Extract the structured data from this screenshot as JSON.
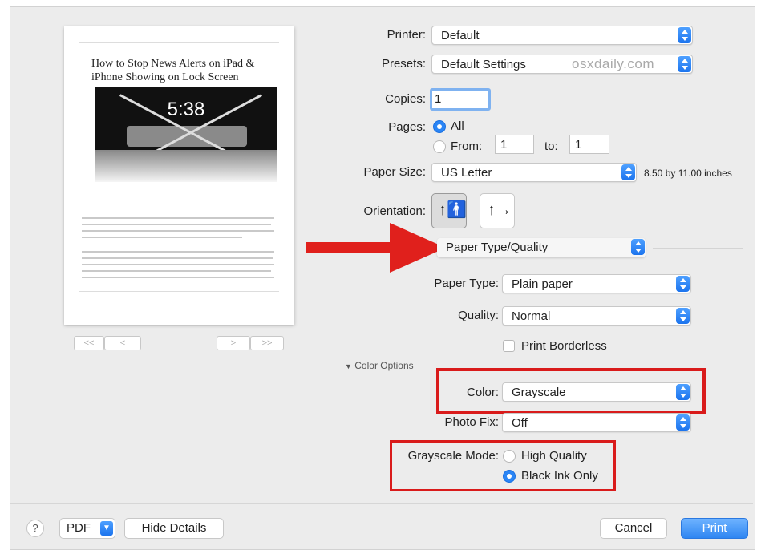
{
  "printer": {
    "label": "Printer:",
    "value": "Default"
  },
  "presets": {
    "label": "Presets:",
    "value": "Default Settings"
  },
  "watermark": "osxdaily.com",
  "copies": {
    "label": "Copies:",
    "value": "1"
  },
  "pages": {
    "label": "Pages:",
    "all_label": "All",
    "from_label": "From:",
    "from_value": "1",
    "to_label": "to:",
    "to_value": "1"
  },
  "paper_size": {
    "label": "Paper Size:",
    "value": "US Letter",
    "dimensions": "8.50 by 11.00 inches"
  },
  "orientation": {
    "label": "Orientation:"
  },
  "section_select": {
    "value": "Paper Type/Quality"
  },
  "paper_type": {
    "label": "Paper Type:",
    "value": "Plain paper"
  },
  "quality": {
    "label": "Quality:",
    "value": "Normal"
  },
  "print_borderless": {
    "label": "Print Borderless"
  },
  "color_options": {
    "label": "Color Options"
  },
  "color": {
    "label": "Color:",
    "value": "Grayscale"
  },
  "photo_fix": {
    "label": "Photo Fix:",
    "value": "Off"
  },
  "grayscale_mode": {
    "label": "Grayscale Mode:",
    "opt_high": "High Quality",
    "opt_black": "Black Ink Only"
  },
  "preview": {
    "title": "How to Stop News Alerts on iPad & iPhone Showing on Lock Screen",
    "time": "5:38",
    "nav_first": "<<",
    "nav_prev": "<",
    "nav_next": ">",
    "nav_last": ">>"
  },
  "footer": {
    "help": "?",
    "pdf": "PDF",
    "hide_details": "Hide Details",
    "cancel": "Cancel",
    "print": "Print"
  },
  "colors": {
    "accent": "#2a85f5",
    "annotation": "#d91b1b",
    "background": "#ececec"
  }
}
